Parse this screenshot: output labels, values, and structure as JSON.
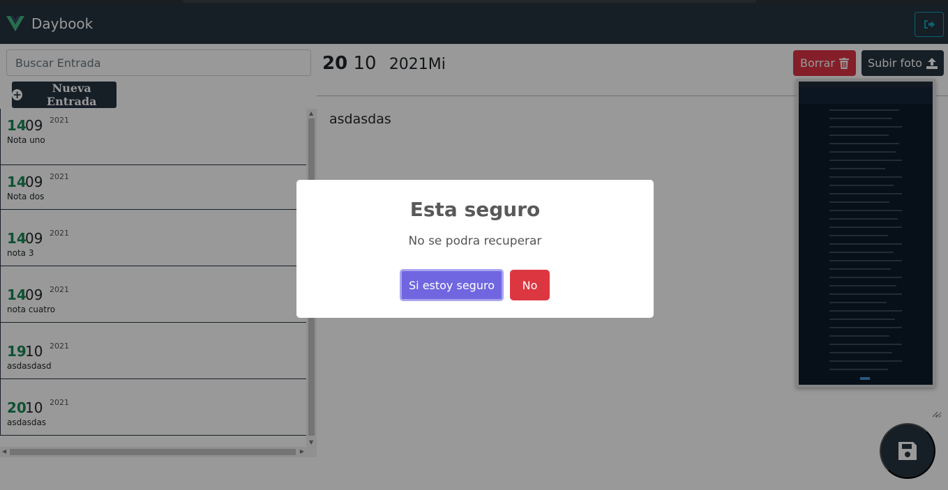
{
  "app": {
    "brand": "Daybook"
  },
  "icons": {
    "logo": "vue-logo-icon",
    "logout": "sign-out-icon",
    "add": "plus-circle-icon",
    "trash": "trash-icon",
    "upload": "upload-icon",
    "save": "floppy-disk-icon"
  },
  "colors": {
    "navbar": "#263340",
    "day": "#198754",
    "danger": "#dc3545",
    "confirm": "#7066e0",
    "cancel": "#dc3741"
  },
  "sidebar": {
    "search_placeholder": "Buscar Entrada",
    "new_entry_label": "Nueva Entrada",
    "entries": [
      {
        "day": "14",
        "month": "09",
        "year": "2021",
        "title": "Nota uno"
      },
      {
        "day": "14",
        "month": "09",
        "year": "2021",
        "title": "Nota dos"
      },
      {
        "day": "14",
        "month": "09",
        "year": "2021",
        "title": "nota 3"
      },
      {
        "day": "14",
        "month": "09",
        "year": "2021",
        "title": "nota cuatro"
      },
      {
        "day": "19",
        "month": "10",
        "year": "2021",
        "title": "asdasdasd"
      },
      {
        "day": "20",
        "month": "10",
        "year": "2021",
        "title": "asdasdas"
      }
    ]
  },
  "entry": {
    "day": "20",
    "month": "10",
    "year_weekday": "2021Mi",
    "delete_label": "Borrar",
    "upload_label": "Subir foto",
    "text": "asdasdas"
  },
  "modal": {
    "title": "Esta seguro",
    "text": "No se podra recuperar",
    "confirm_label": "Si estoy seguro",
    "cancel_label": "No"
  }
}
